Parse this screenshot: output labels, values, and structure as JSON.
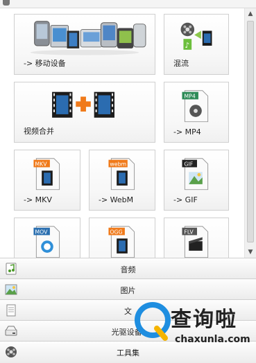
{
  "tiles": [
    {
      "label": "-> 移动设备",
      "icon": "mobile-devices-icon"
    },
    {
      "label": "混流",
      "icon": "mux-film-reel-icon"
    },
    {
      "label": "视频合并",
      "icon": "video-join-icon"
    },
    {
      "label": "-> MP4",
      "icon": "mp4-file-icon",
      "badge": "MP4"
    },
    {
      "label": "-> MKV",
      "icon": "mkv-file-icon",
      "badge": "MKV"
    },
    {
      "label": "-> WebM",
      "icon": "webm-file-icon",
      "badge": "webm"
    },
    {
      "label": "-> GIF",
      "icon": "gif-file-icon",
      "badge": "GIF"
    },
    {
      "label": "",
      "icon": "mov-file-icon",
      "badge": "MOV"
    },
    {
      "label": "",
      "icon": "ogg-file-icon",
      "badge": "OGG"
    },
    {
      "label": "",
      "icon": "flv-file-icon",
      "badge": "FLV"
    }
  ],
  "categories": [
    {
      "label": "音频",
      "icon": "audio-note-icon"
    },
    {
      "label": "图片",
      "icon": "picture-icon"
    },
    {
      "label": "文",
      "icon": "document-icon"
    },
    {
      "label": "光驱设备\\",
      "icon": "optical-drive-icon"
    },
    {
      "label": "工具集",
      "icon": "toolbox-icon"
    }
  ],
  "watermark": {
    "text": "查询啦",
    "url": "chaxunla.com"
  },
  "colors": {
    "accent_orange": "#f07a1a",
    "gif_badge": "#222222",
    "mp4_badge": "#2e8b57",
    "mov_badge": "#2a6fb0",
    "film_blue": "#2b6cb0",
    "wm_blue": "#1f8ee0",
    "wm_yellow": "#f5b400"
  }
}
